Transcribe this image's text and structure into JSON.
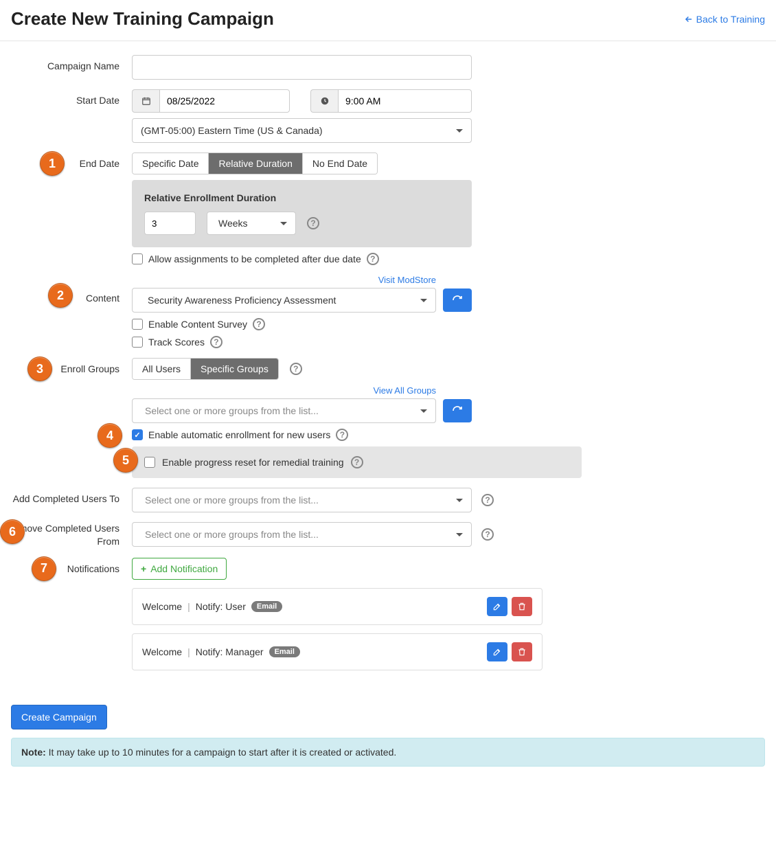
{
  "header": {
    "title": "Create New Training Campaign",
    "back_label": "Back to Training"
  },
  "labels": {
    "campaign_name": "Campaign Name",
    "start_date": "Start Date",
    "end_date": "End Date",
    "content": "Content",
    "enroll_groups": "Enroll Groups",
    "add_completed": "Add Completed Users To",
    "remove_completed": "Remove Completed Users From",
    "notifications": "Notifications"
  },
  "start": {
    "date": "08/25/2022",
    "time": "9:00 AM",
    "timezone": "(GMT-05:00) Eastern Time (US & Canada)"
  },
  "end": {
    "option_specific": "Specific Date",
    "option_relative": "Relative Duration",
    "option_none": "No End Date",
    "rel_title": "Relative Enrollment Duration",
    "rel_value": "3",
    "rel_unit": "Weeks",
    "allow_after_due": "Allow assignments to be completed after due date"
  },
  "content": {
    "modstore_link": "Visit ModStore",
    "selected": "Security Awareness Proficiency Assessment",
    "survey_label": "Enable Content Survey",
    "track_label": "Track Scores"
  },
  "enroll": {
    "opt_all": "All Users",
    "opt_specific": "Specific Groups",
    "view_all": "View All Groups",
    "placeholder": "Select one or more groups from the list...",
    "auto_enroll_label": "Enable automatic enrollment for new users",
    "reset_label": "Enable progress reset for remedial training"
  },
  "group_select_placeholder": "Select one or more groups from the list...",
  "notifications": {
    "add_label": "Add Notification",
    "items": [
      {
        "type": "Welcome",
        "notify": "Notify: User",
        "channel": "Email"
      },
      {
        "type": "Welcome",
        "notify": "Notify: Manager",
        "channel": "Email"
      }
    ]
  },
  "footer": {
    "create_label": "Create Campaign",
    "note_bold": "Note:",
    "note_text": " It may take up to 10 minutes for a campaign to start after it is created or activated."
  },
  "steps": [
    "1",
    "2",
    "3",
    "4",
    "5",
    "6",
    "7"
  ]
}
